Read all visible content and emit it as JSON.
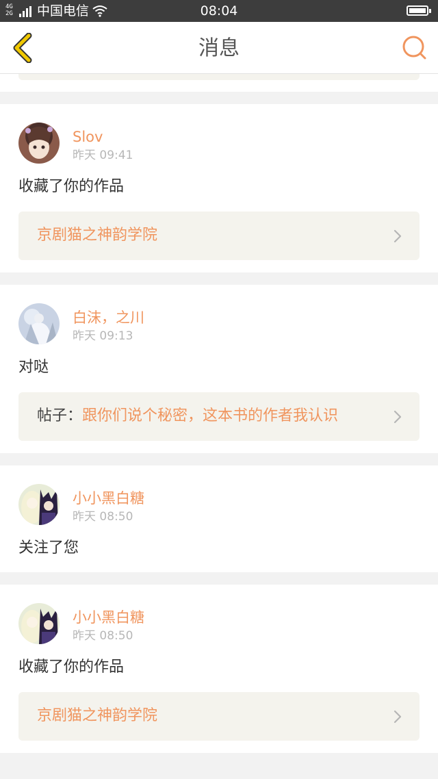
{
  "status_bar": {
    "signal_label_top": "4G",
    "signal_label_bottom": "2G",
    "carrier": "中国电信",
    "time": "08:04"
  },
  "nav": {
    "title": "消息",
    "back_icon": "chevron-left-icon",
    "search_icon": "search-icon",
    "accent_color": "#f0955e"
  },
  "messages": [
    {
      "user": "Slov",
      "time": "昨天 09:41",
      "action": "收藏了你的作品",
      "ref_prefix": "",
      "ref_text": "京剧猫之神韵学院"
    },
    {
      "user": "白沫，之川",
      "time": "昨天 09:13",
      "action": "对哒",
      "ref_prefix": "帖子：",
      "ref_text": "跟你们说个秘密，这本书的作者我认识"
    },
    {
      "user": "小小黑白糖",
      "time": "昨天 08:50",
      "action": "关注了您"
    },
    {
      "user": "小小黑白糖",
      "time": "昨天 08:50",
      "action": "收藏了你的作品",
      "ref_prefix": "",
      "ref_text": "京剧猫之神韵学院"
    }
  ]
}
